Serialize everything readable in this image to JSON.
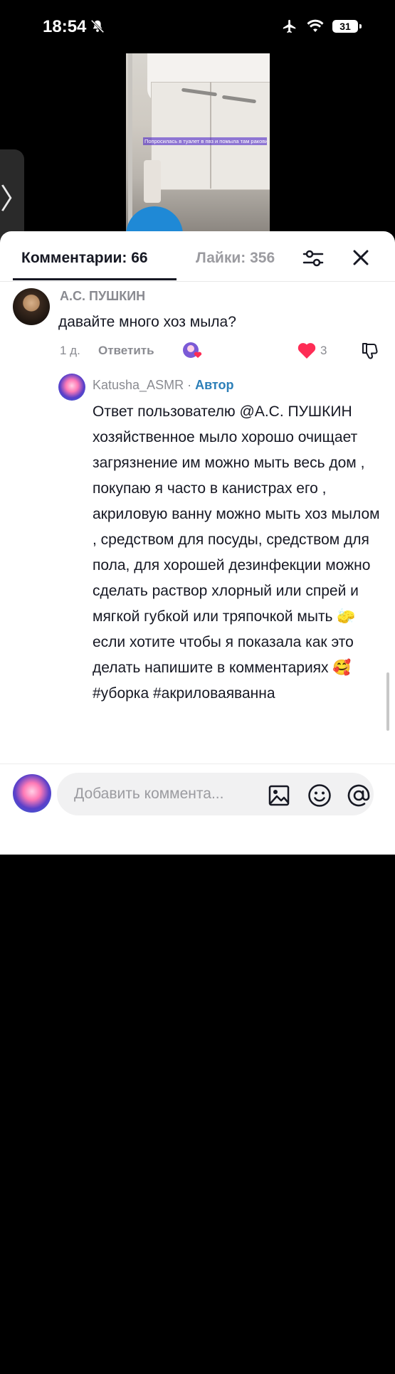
{
  "status": {
    "time": "18:54",
    "battery": "31"
  },
  "video": {
    "overlay_text": "Попросилась в туалет в пвз и помыла там раковину"
  },
  "tabs": {
    "comments_label": "Комментарии: 66",
    "likes_label": "Лайки: 356"
  },
  "comment1": {
    "username": "А.С. ПУШКИН",
    "text": "давайте много хоз мыла?",
    "time": "1 д.",
    "reply_label": "Ответить",
    "like_count": "3"
  },
  "comment2": {
    "username": "Katusha_ASMR",
    "separator": " · ",
    "author_badge": "Автор",
    "text": "Ответ пользователю @А.С. ПУШКИН хозяйственное мыло хорошо очищает загрязнение им можно мыть весь дом , покупаю я часто в канистрах его , акриловую ванну можно мыть хоз мылом , средством для посуды, средством для пола, для хорошей дезинфекции можно сделать раствор хлорный или спрей и мягкой губкой или тряпочкой мыть 🧽 если хотите чтобы я показала как это делать напишите в комментариях 🥰 #уборка #акриловаяванна"
  },
  "input": {
    "placeholder": "Добавить коммента..."
  },
  "icons": {
    "bell": "bell-slash-icon",
    "airplane": "airplane-icon",
    "wifi": "wifi-icon",
    "filter": "sliders-icon",
    "close": "close-icon",
    "heart": "heart-icon",
    "dislike": "thumbs-down-icon",
    "image": "image-icon",
    "emoji": "emoji-icon",
    "at": "at-icon"
  },
  "colors": {
    "like": "#fe2c55",
    "author": "#2c7fb8",
    "text": "#161823",
    "muted": "#8a8b91"
  }
}
